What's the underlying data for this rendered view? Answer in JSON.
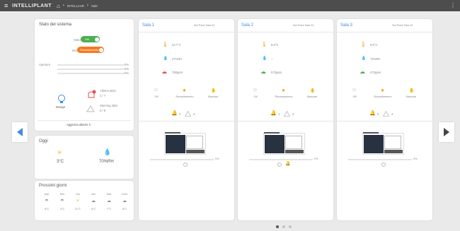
{
  "topbar": {
    "brand": "INTELLIPLANT",
    "crumb1": "INTELLIAIR",
    "crumb2": "Sale"
  },
  "system": {
    "title": "Stato del sistema",
    "stato_label": "Stato",
    "stato_value": "ON",
    "modo_label": "Modo",
    "modo_value": "Riscaldamento",
    "aperture_label": "Aperture",
    "aperture": [
      {
        "value": "0%",
        "pct": 0
      },
      {
        "value": "0%",
        "pct": 0
      },
      {
        "value": "0%",
        "pct": 0
      }
    ],
    "design_label": "Design",
    "alarm_label": "Allarmi attivi",
    "alarm_value": "4 / 7",
    "warning_label": "Warning attivi",
    "warning_value": "0 / 8",
    "refresh_label": "Aggiorna allarmi",
    "alarm_badge": "!"
  },
  "today": {
    "title": "Oggi",
    "temp": "3°C",
    "humidity": "70%RH"
  },
  "forecast": {
    "title": "Prossimi giorni",
    "days": [
      "Mar",
      "Mer",
      "Gio",
      "Ven",
      "Sab",
      "Dom"
    ],
    "values": [
      "8°C",
      "4°C",
      "11°C",
      "9°C",
      "7°C",
      "8°C"
    ]
  },
  "rooms": [
    {
      "name": "Sala 1",
      "setpoint_label": "Set Point Sala 22",
      "temp": "22,7°C",
      "humidity": "27%RH",
      "co2": "780ppm",
      "co2_color": "#e84f4f",
      "modes": [
        "Off",
        "Riscaldamento",
        "Manuale"
      ],
      "bell_count": "2",
      "warn_count": "4",
      "bell_active": false,
      "progress_value": "0%",
      "progress_pct": 0,
      "fan_alert": false
    },
    {
      "name": "Sala 2",
      "setpoint_label": "Set Point Sala 22",
      "temp": "8,5°C",
      "humidity": "--",
      "co2": "572ppm",
      "co2_color": "#49b249",
      "modes": [
        "Off",
        "Riscaldamento",
        "Manuale"
      ],
      "bell_count": "1",
      "warn_count": "3",
      "bell_active": true,
      "progress_value": "0%",
      "progress_pct": 0,
      "fan_alert": true
    },
    {
      "name": "Sala 3",
      "setpoint_label": "Set Point Sala 22",
      "temp": "8,5°C",
      "humidity": "72%RH",
      "co2": "472ppm",
      "co2_color": "#49b249",
      "modes": [
        "Off",
        "Riscaldamento",
        "Manuale"
      ],
      "bell_count": "0",
      "warn_count": "4",
      "bell_active": false,
      "progress_value": "0%",
      "progress_pct": 0,
      "fan_alert": false
    }
  ],
  "icons": {
    "prev": "chevron-left-icon",
    "next": "chevron-right-icon",
    "menu": "hamburger-icon",
    "home": "home-icon"
  },
  "colors": {
    "accent": "#3b8ee6",
    "on_green": "#4caf50",
    "heating_orange": "#f47a21",
    "alarm_red": "#e84f4f"
  },
  "pagination": {
    "count": 3,
    "active": 0
  }
}
